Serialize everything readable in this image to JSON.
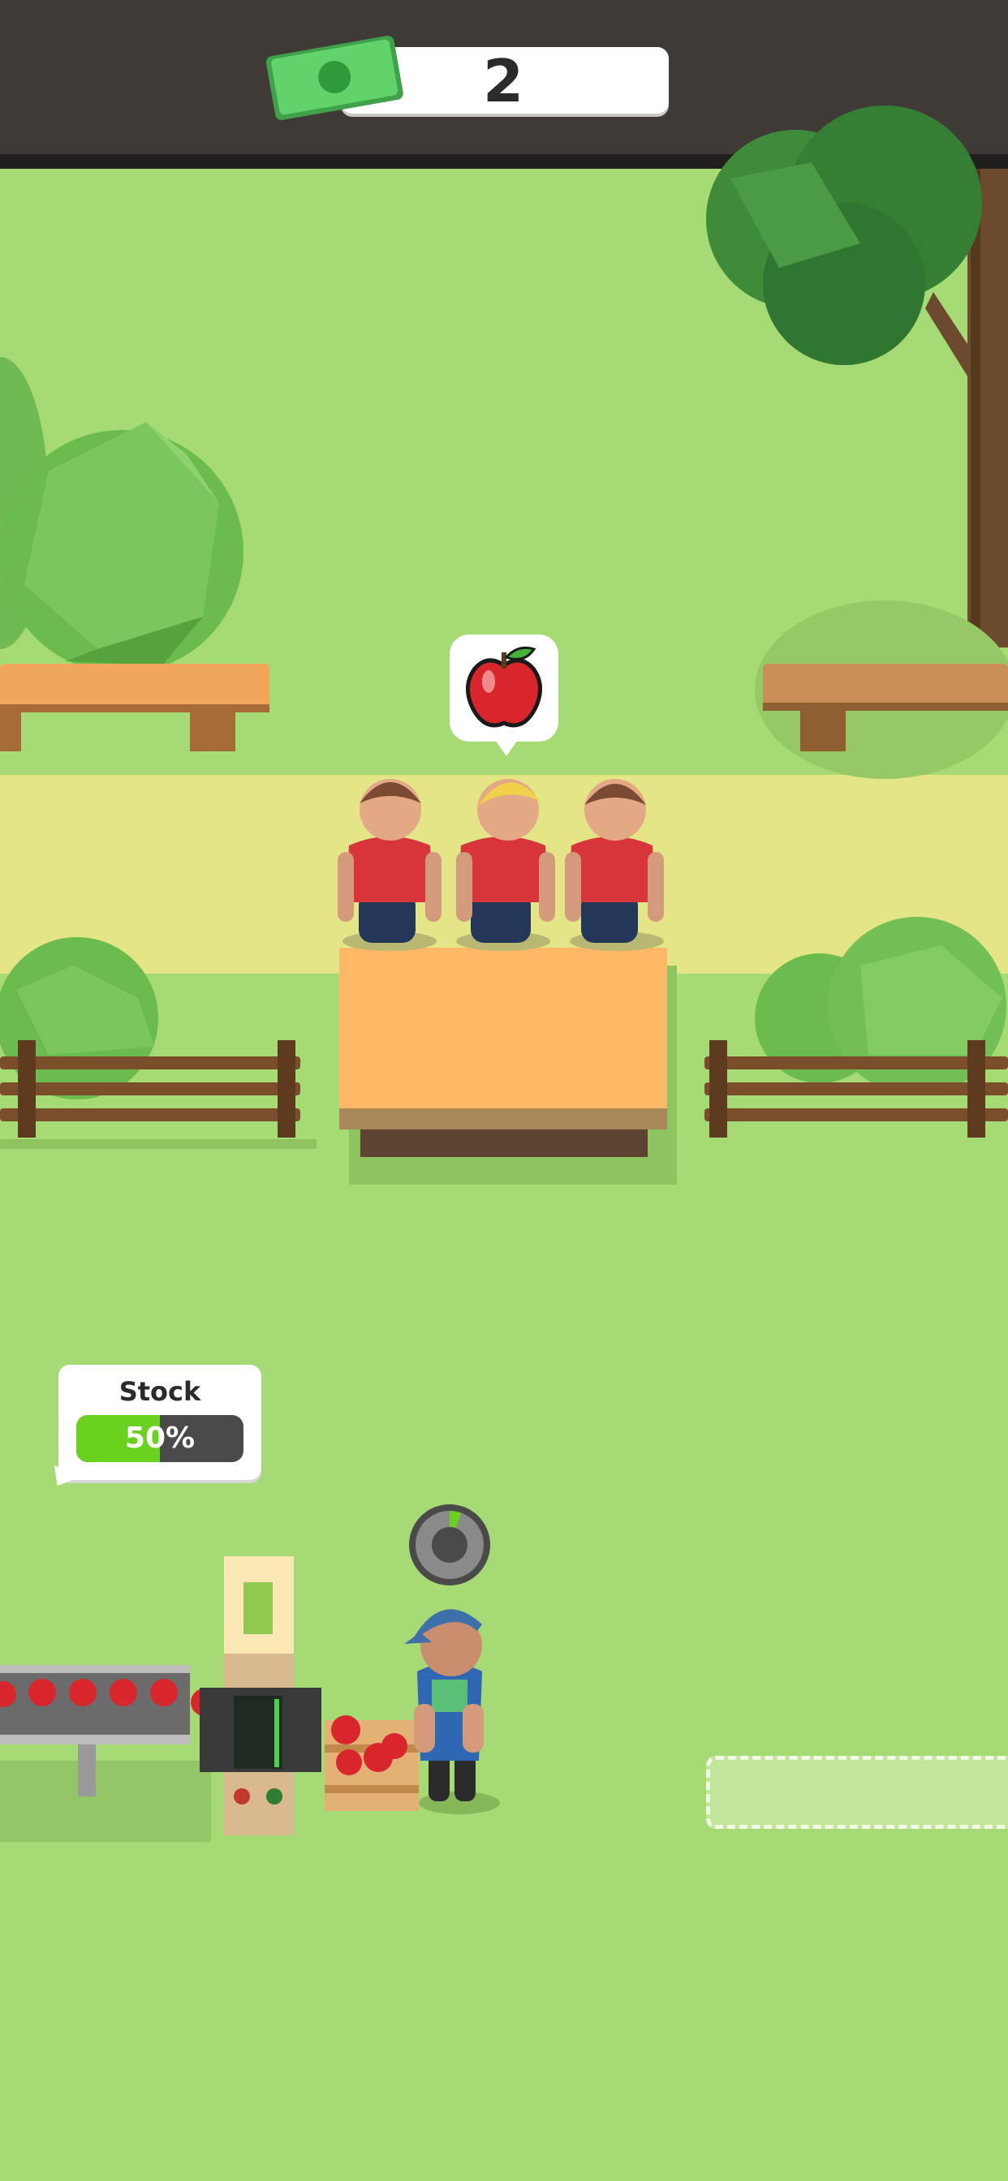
{
  "hud": {
    "money": "2",
    "cash_icon": "cash-banknote-icon"
  },
  "customer_request": {
    "icon": "apple-icon"
  },
  "stock": {
    "label": "Stock",
    "percent_text": "50%",
    "fill_fraction": 0.5
  },
  "colors": {
    "ground": "#a6da74",
    "path": "#e3e586",
    "counter_top": "#ffb865",
    "hud_bar": "#403a37",
    "stock_fill": "#68d21f",
    "cash_green": "#5fd46a"
  }
}
